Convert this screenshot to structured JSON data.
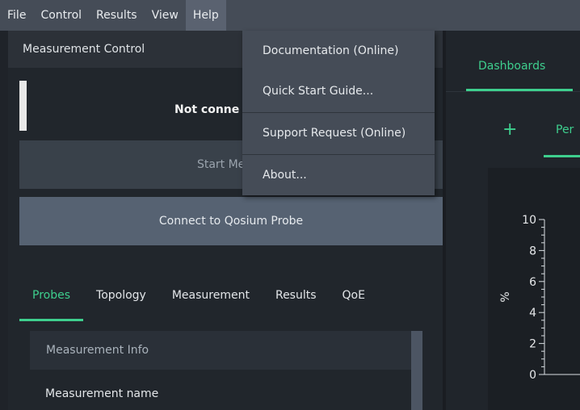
{
  "menubar": {
    "items": [
      {
        "label": "File"
      },
      {
        "label": "Control"
      },
      {
        "label": "Results"
      },
      {
        "label": "View"
      },
      {
        "label": "Help",
        "active": true
      }
    ]
  },
  "help_menu": {
    "items": [
      {
        "label": "Documentation (Online)"
      },
      {
        "label": "Quick Start Guide..."
      },
      {
        "label": "Support Request (Online)"
      },
      {
        "label": "About..."
      }
    ]
  },
  "measurement_control": {
    "title": "Measurement Control",
    "status_text": "Not conne",
    "start_button": "Start Measu",
    "connect_button": "Connect to Qosium Probe"
  },
  "tabs": {
    "items": [
      {
        "label": "Probes",
        "active": true
      },
      {
        "label": "Topology"
      },
      {
        "label": "Measurement"
      },
      {
        "label": "Results"
      },
      {
        "label": "QoE"
      }
    ]
  },
  "measurement_info": {
    "header": "Measurement Info",
    "field_label": "Measurement name"
  },
  "right_panel": {
    "dashboards_tab": "Dashboards",
    "add_icon": "plus-icon",
    "sub_tab": "Per"
  },
  "chart_data": {
    "type": "line",
    "ylabel": "%",
    "y_ticks": [
      "10",
      "8",
      "6",
      "4",
      "2",
      "0"
    ],
    "ylim": [
      0,
      10
    ],
    "series": []
  },
  "colors": {
    "accent": "#3ecf8e",
    "menubar": "#454c57",
    "background": "#1f2329"
  }
}
